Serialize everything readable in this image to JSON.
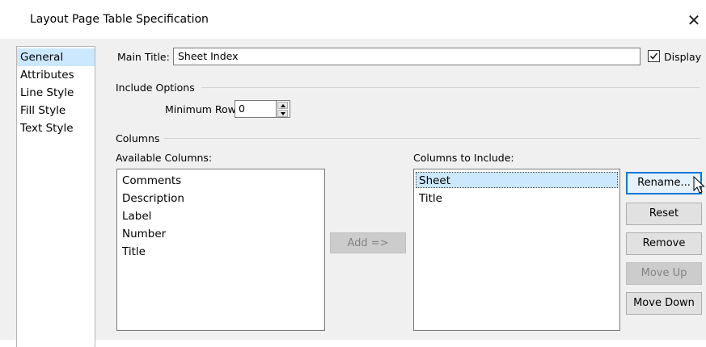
{
  "window": {
    "title": "Layout Page Table Specification",
    "close_glyph": "✕"
  },
  "nav": {
    "items": [
      {
        "label": "General",
        "selected": true
      },
      {
        "label": "Attributes"
      },
      {
        "label": "Line Style"
      },
      {
        "label": "Fill Style"
      },
      {
        "label": "Text Style"
      }
    ]
  },
  "general": {
    "main_title_label": "Main Title:",
    "main_title_value": "Sheet Index",
    "display_label": "Display",
    "display_checked": true,
    "include_options_label": "Include Options",
    "min_rows_label": "Minimum Rows:",
    "min_rows_value": "0",
    "columns_label": "Columns",
    "available_columns_label": "Available Columns:",
    "available_columns": [
      "Comments",
      "Description",
      "Label",
      "Number",
      "Title"
    ],
    "add_button_label": "Add =>",
    "columns_to_include_label": "Columns to Include:",
    "columns_to_include": [
      "Sheet",
      "Title"
    ],
    "selected_column": "Sheet"
  },
  "buttons": {
    "rename": "Rename...",
    "reset": "Reset",
    "remove": "Remove",
    "move_up": "Move Up",
    "move_down": "Move Down"
  },
  "colors": {
    "selection": "#cce8ff",
    "default_button_border": "#0078d7",
    "dialog_background": "#f0f0f0"
  }
}
